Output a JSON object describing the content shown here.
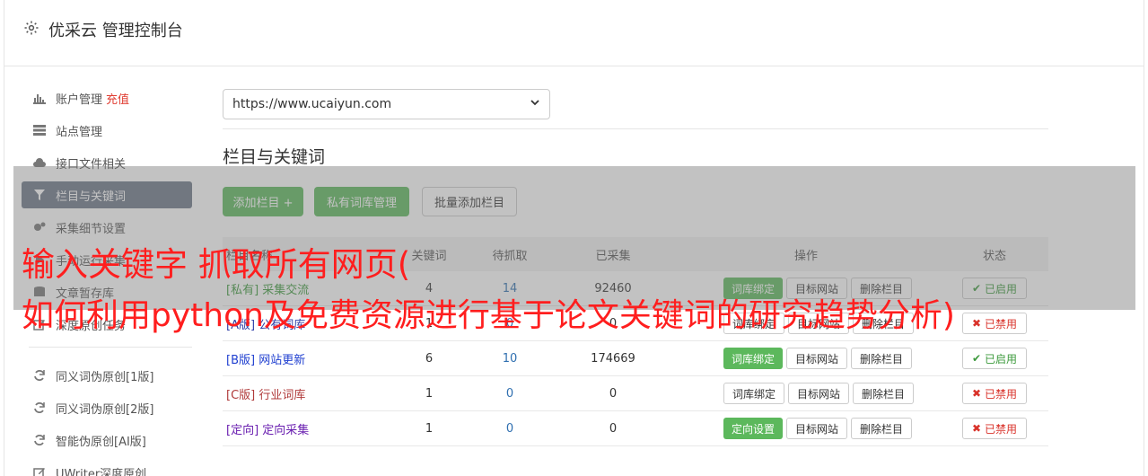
{
  "header": {
    "title": "优采云 管理控制台",
    "icon": "gear-icon"
  },
  "sidebar": {
    "items": [
      {
        "label": "账户管理",
        "extra": "充值",
        "icon": "bar-chart-icon",
        "active": false
      },
      {
        "label": "站点管理",
        "extra": "",
        "icon": "server-icon",
        "active": false
      },
      {
        "label": "接口文件相关",
        "extra": "",
        "icon": "cloud-upload-icon",
        "active": false
      },
      {
        "label": "栏目与关键词",
        "extra": "",
        "icon": "filter-icon",
        "active": true
      },
      {
        "label": "采集细节设置",
        "extra": "",
        "icon": "cogs-icon",
        "active": false
      },
      {
        "label": "手动运行采集",
        "extra": "",
        "icon": "play-icon",
        "active": false
      },
      {
        "label": "文章暂存库",
        "extra": "",
        "icon": "database-icon",
        "active": false
      },
      {
        "label": "深度原创任务",
        "extra": "",
        "icon": "edit-icon",
        "active": false
      }
    ],
    "items2": [
      {
        "label": "同义词伪原创[1版]",
        "icon": "refresh-icon"
      },
      {
        "label": "同义词伪原创[2版]",
        "icon": "refresh-icon"
      },
      {
        "label": "智能伪原创[AI版]",
        "icon": "refresh-icon"
      },
      {
        "label": "UWriter深度原创",
        "icon": "pencil-icon"
      }
    ]
  },
  "site_select": {
    "value": "https://www.ucaiyun.com"
  },
  "section": {
    "title": "栏目与关键词"
  },
  "toolbar": {
    "add_column": "添加栏目 +",
    "private_lib": "私有词库管理",
    "batch_add": "批量添加栏目"
  },
  "table": {
    "headers": [
      "栏目名称",
      "关键词",
      "待抓取",
      "已采集",
      "操作",
      "状态"
    ],
    "rows": [
      {
        "tag": "[私有]",
        "name": "采集交流",
        "keywords": "4",
        "pending": "14",
        "collected": "92460",
        "op1": "词库绑定",
        "op1_green": true,
        "op2": "目标网站",
        "op3": "删除栏目",
        "status": "已启用",
        "enabled": true,
        "color": "#3c9a3c"
      },
      {
        "tag": "[A版]",
        "name": "公有词库",
        "keywords": "1",
        "pending": "0",
        "collected": "0",
        "op1": "词库绑定",
        "op1_green": false,
        "op2": "目标网站",
        "op3": "删除栏目",
        "status": "已禁用",
        "enabled": false,
        "color": "#2f3fa8"
      },
      {
        "tag": "[B版]",
        "name": "网站更新",
        "keywords": "6",
        "pending": "10",
        "collected": "174669",
        "op1": "词库绑定",
        "op1_green": true,
        "op2": "目标网站",
        "op3": "删除栏目",
        "status": "已启用",
        "enabled": true,
        "color": "#1f3fd0"
      },
      {
        "tag": "[C版]",
        "name": "行业词库",
        "keywords": "1",
        "pending": "0",
        "collected": "0",
        "op1": "词库绑定",
        "op1_green": false,
        "op2": "目标网站",
        "op3": "删除栏目",
        "status": "已禁用",
        "enabled": false,
        "color": "#b03a3a"
      },
      {
        "tag": "[定向]",
        "name": "定向采集",
        "keywords": "1",
        "pending": "0",
        "collected": "0",
        "op1": "定向设置",
        "op1_green": true,
        "op2": "目标网站",
        "op3": "删除栏目",
        "status": "已禁用",
        "enabled": false,
        "color": "#6a1fb0"
      }
    ]
  },
  "overlay": {
    "line1": "输入关键字 抓取所有网页(",
    "line2": "如何利用python及免费资源进行基于论文关键词的研究趋势分析)"
  }
}
